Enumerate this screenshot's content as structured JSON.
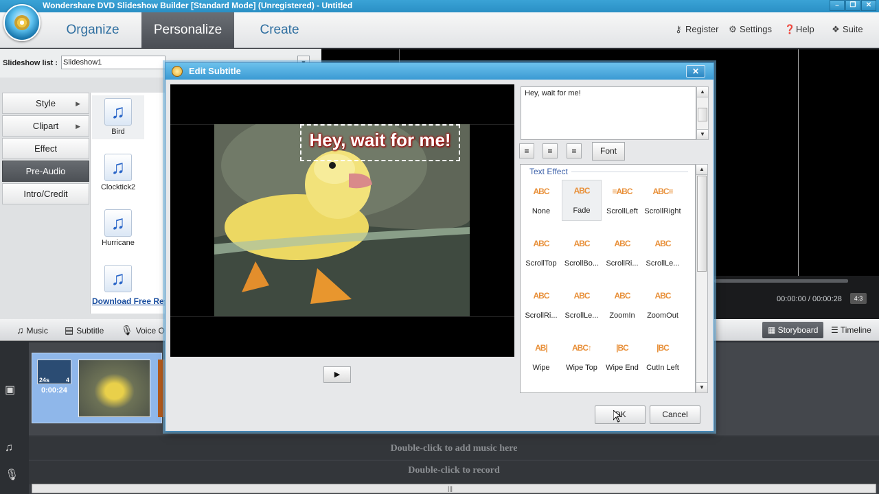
{
  "window": {
    "title": "Wondershare DVD Slideshow Builder [Standard Mode] (Unregistered) - Untitled",
    "controls": [
      "–",
      "❐",
      "✕"
    ]
  },
  "menu": {
    "tabs": [
      "Organize",
      "Personalize",
      "Create"
    ],
    "active_tab": "Personalize",
    "links": [
      {
        "label": "Register",
        "icon": "key-icon"
      },
      {
        "label": "Settings",
        "icon": "gear-icon"
      },
      {
        "label": "Help",
        "icon": "help-icon"
      },
      {
        "label": "Suite",
        "icon": "suite-icon"
      }
    ]
  },
  "slideshow_list": {
    "label": "Slideshow list :",
    "value": "Slideshow1"
  },
  "sidebar": {
    "items": [
      {
        "label": "Style",
        "has_arrow": true
      },
      {
        "label": "Clipart",
        "has_arrow": true
      },
      {
        "label": "Effect",
        "has_arrow": false
      },
      {
        "label": "Pre-Audio",
        "has_arrow": false
      },
      {
        "label": "Intro/Credit",
        "has_arrow": false
      }
    ],
    "active": "Pre-Audio"
  },
  "music_list": [
    "Bird",
    "Clocktick2",
    "Hurricane",
    ""
  ],
  "download_link": "Download Free Res",
  "preview": {
    "time": "00:00:00 / 00:00:28",
    "ratio": "4:3"
  },
  "bottom_toolbar": {
    "tools": [
      "Music",
      "Subtitle",
      "Voice Ove"
    ],
    "views": [
      "Storyboard",
      "Timeline"
    ],
    "active_view": "Storyboard"
  },
  "storyboard": {
    "clip_duration": "0:00:24",
    "clip_badge_left": "24s",
    "clip_badge_right": "4",
    "music_hint": "Double-click to add music here",
    "record_hint": "Double-click to record"
  },
  "dialog": {
    "title": "Edit Subtitle",
    "subtitle_text": "Hey, wait for me!",
    "font_button": "Font",
    "effects_header": "Text Effect",
    "effects": [
      {
        "label": "None",
        "icon": "ABC"
      },
      {
        "label": "Fade",
        "icon": "ABC"
      },
      {
        "label": "ScrollLeft",
        "icon": "≡ABC"
      },
      {
        "label": "ScrollRight",
        "icon": "ABC≡"
      },
      {
        "label": "ScrollTop",
        "icon": "ABC"
      },
      {
        "label": "ScrollBo...",
        "icon": "ABC"
      },
      {
        "label": "ScrollRi...",
        "icon": "ABC"
      },
      {
        "label": "ScrollLe...",
        "icon": "ABC"
      },
      {
        "label": "ScrollRi...",
        "icon": "ABC"
      },
      {
        "label": "ScrollLe...",
        "icon": "ABC"
      },
      {
        "label": "ZoomIn",
        "icon": "ABC"
      },
      {
        "label": "ZoomOut",
        "icon": "ABC"
      },
      {
        "label": "Wipe",
        "icon": "AB|"
      },
      {
        "label": "Wipe Top",
        "icon": "ABC↑"
      },
      {
        "label": "Wipe End",
        "icon": "|BC"
      },
      {
        "label": "CutIn Left",
        "icon": "|BC"
      }
    ],
    "selected_effect": "Fade",
    "ok_label": "OK",
    "cancel_label": "Cancel"
  },
  "colors": {
    "titlebar": "#2a8fc5",
    "accent_blue": "#2f6fa0",
    "effect_orange": "#e8903a",
    "subtitle_glow": "#b01010"
  }
}
